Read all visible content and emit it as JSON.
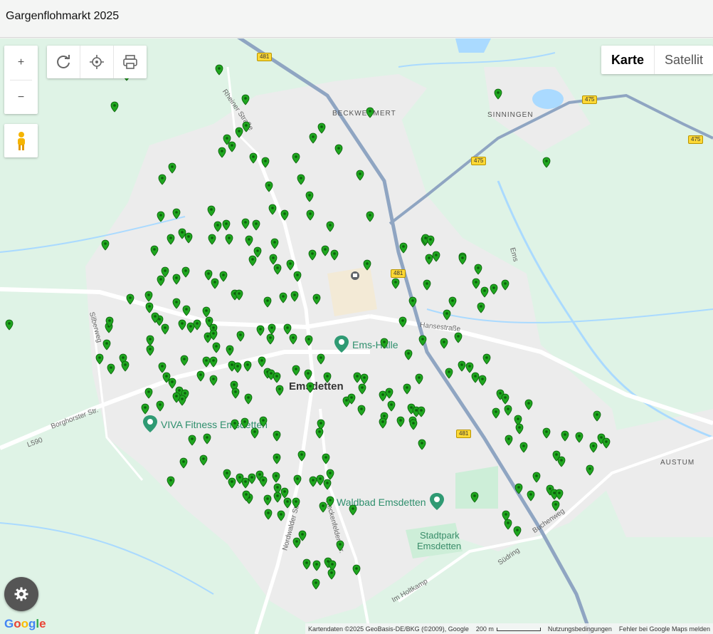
{
  "header": {
    "title": "Gargenflohmarkt 2025"
  },
  "controls": {
    "zoom_in": "+",
    "zoom_out": "−",
    "map_type": {
      "karte": "Karte",
      "satellit": "Satellit"
    }
  },
  "labels": {
    "beckwermert": "BECKWERMERT",
    "sinningen": "SINNINGEN",
    "austum": "AUSTUM",
    "emsdetten": "Emsdetten",
    "ems_halle": "Ems-Halle",
    "viva": "VIVA Fitness Emsdetten",
    "waldbad": "Waldbad Emsdetten",
    "stadtpark": "Stadtpark",
    "stadtpark2": "Emsdetten",
    "hansestrasse": "Hansestraße",
    "borghorster": "Borghorster Str.",
    "l590": "L590",
    "silberweg": "Silberweg",
    "rheiner": "Rheiner Straße",
    "ems": "Ems",
    "buchenweg": "Buchenweg",
    "sudring": "Südring",
    "im_holtkamp": "Im Holtkamp",
    "nordwalder": "Nordwalder Str.",
    "reckenfelder": "Reckenfelder Str."
  },
  "shields": [
    "481",
    "475",
    "475",
    "475",
    "481",
    "481"
  ],
  "attribution": {
    "data": "Kartendaten ©2025 GeoBasis-DE/BKG (©2009), Google",
    "scale": "200 m",
    "terms": "Nutzungsbedingungen",
    "report": "Fehler bei Google Maps melden"
  },
  "google_logo": "Google",
  "colors": {
    "marker": "#1fa61f",
    "marker_dark": "#0d5e0d",
    "motorway": "#8fa5c2",
    "water": "#aadaff",
    "poi": "#2f9a73"
  },
  "icons": [
    "refresh-icon",
    "locate-icon",
    "print-icon",
    "pegman-icon",
    "gear-icon",
    "map-marker-icon"
  ]
}
